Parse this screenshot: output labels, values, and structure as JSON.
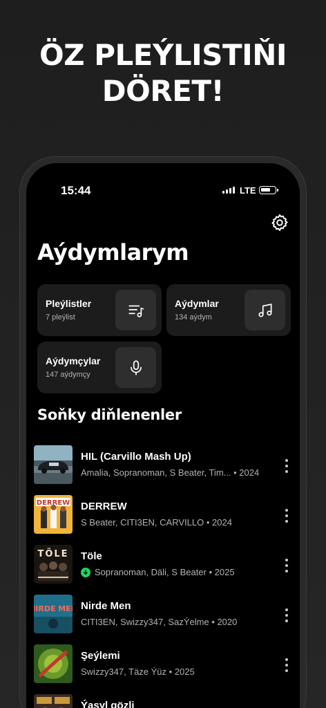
{
  "promo": {
    "line1": "ÖZ PLEÝLISTIŇI",
    "line2": "DÖRET!"
  },
  "status_bar": {
    "time": "15:44",
    "network": "LTE"
  },
  "page_title": "Aýdymlarym",
  "cards": [
    {
      "title": "Pleýlistler",
      "subtitle": "7 pleýlist",
      "icon": "playlist-icon"
    },
    {
      "title": "Aýdymlar",
      "subtitle": "134 aýdym",
      "icon": "music-note-icon"
    },
    {
      "title": "Aýdymçylar",
      "subtitle": "147 aýdymçy",
      "icon": "microphone-icon"
    }
  ],
  "section_title": "Soňky diňlenenler",
  "recent": [
    {
      "title": "HIL (Carvillo Mash Up)",
      "meta": "Amalia, Sopranoman, S Beater, Tim... • 2024",
      "downloaded": false
    },
    {
      "title": "DERREW",
      "meta": "S Beater, CITI3EN, CARVILLO • 2024",
      "downloaded": false,
      "art_text": "DERREW"
    },
    {
      "title": "Töle",
      "meta": "Sopranoman, Däli, S Beater • 2025",
      "downloaded": true,
      "art_text": "TÖLE"
    },
    {
      "title": "Nirde Men",
      "meta": "CITI3EN, Swizzy347, SazÝelme • 2020",
      "downloaded": false,
      "art_text": "NIRDE MEN"
    },
    {
      "title": "Şeýlemi",
      "meta": "Swizzy347, Täze Ýüz • 2025",
      "downloaded": false
    },
    {
      "title": "Ýaşyl gözli",
      "meta": "",
      "downloaded": false
    }
  ],
  "colors": {
    "background": "#000000",
    "card": "#1c1c1c",
    "accent": "#1ed760",
    "muted": "#b3b3b3"
  }
}
